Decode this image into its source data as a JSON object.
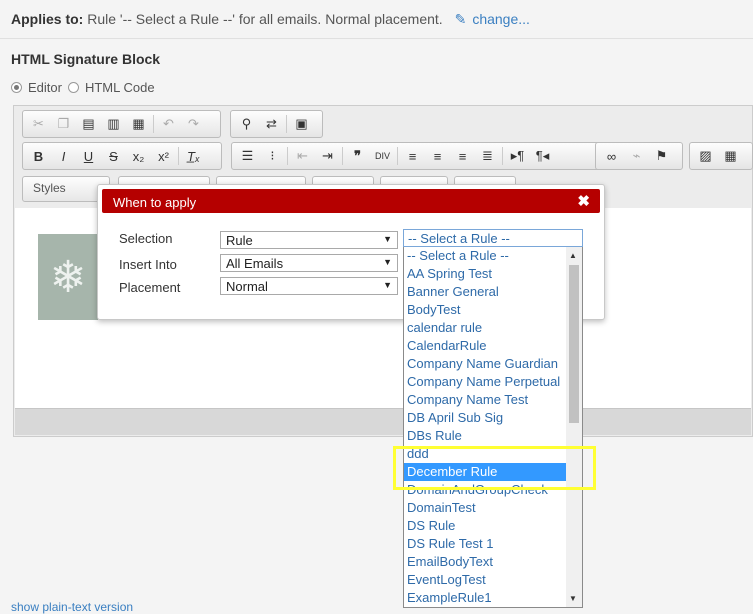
{
  "applies": {
    "label": "Applies to:",
    "text": "Rule '-- Select a Rule --' for all emails. Normal placement.",
    "change_link": "change..."
  },
  "section": {
    "title": "HTML Signature Block",
    "mode_editor": "Editor",
    "mode_html": "HTML Code",
    "selected_mode": "Editor"
  },
  "toolbar": {
    "styles_label": "Styles"
  },
  "dialog": {
    "title": "When to apply",
    "close": "✖",
    "selection_label": "Selection",
    "selection_value": "Rule",
    "insert_label": "Insert Into",
    "insert_value": "All Emails",
    "placement_label": "Placement",
    "placement_value": "Normal",
    "rule_value": "-- Select a Rule --"
  },
  "rules": [
    "-- Select a Rule --",
    "AA Spring Test",
    "Banner General",
    "BodyTest",
    "calendar rule",
    "CalendarRule",
    "Company Name Guardian",
    "Company Name Perpetual",
    "Company Name Test",
    "DB April Sub Sig",
    "DBs Rule",
    "ddd",
    "December Rule",
    "DomainAndGroupCheck",
    "DomainTest",
    "DS Rule",
    "DS Rule Test 1",
    "EmailBodyText",
    "EventLogTest",
    "ExampleRule1"
  ],
  "highlighted_rule": "December Rule",
  "bottom_link": "show plain-text version",
  "colors": {
    "dialog_header": "#b50000",
    "link": "#3a7fc1",
    "selection": "#3399ff",
    "annotation": "#ffff33"
  }
}
